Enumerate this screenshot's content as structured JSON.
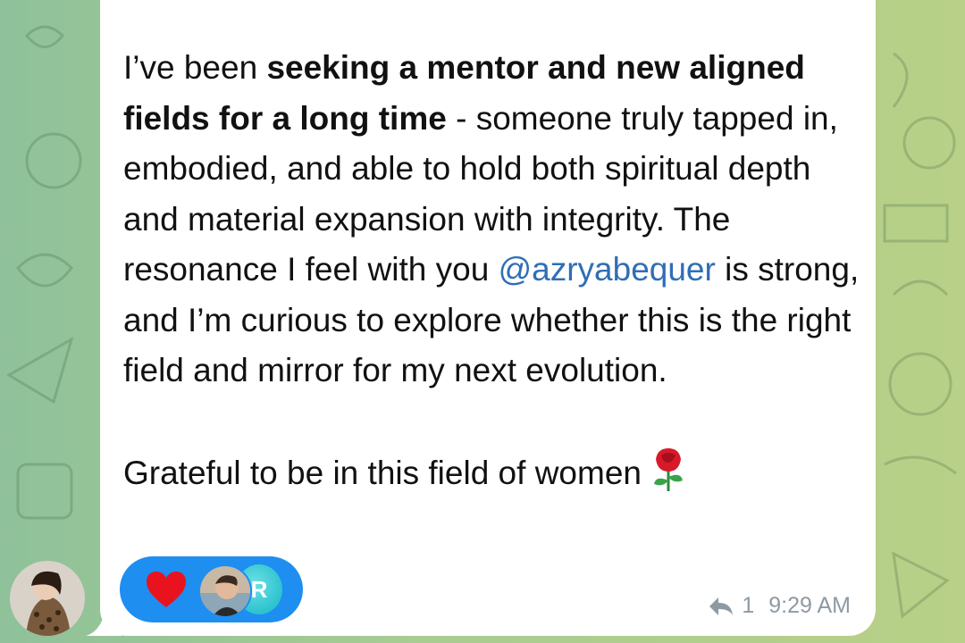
{
  "message": {
    "intro": "I’ve been ",
    "bold": "seeking a mentor and new aligned fields for a long time",
    "after_bold": " - someone truly tapped in, embodied, and able to hold both spiritual depth and material expansion with integrity. The resonance I feel with you ",
    "mention": "@azryabequer",
    "after_mention": "  is strong, and I’m curious to explore whether this is the right field and mirror for my next evolution.",
    "closing": "Grateful to be in this field of women"
  },
  "reactions": {
    "emoji": "heart",
    "second_avatar_initial": "R"
  },
  "meta": {
    "replies": "1",
    "time": "9:29 AM"
  },
  "colors": {
    "mention": "#2f6eb5",
    "reaction_pill": "#1e8ef0",
    "meta_text": "#8e9aa3"
  },
  "icons": [
    "heart-icon",
    "reply-arrow-icon",
    "rose-emoji"
  ]
}
